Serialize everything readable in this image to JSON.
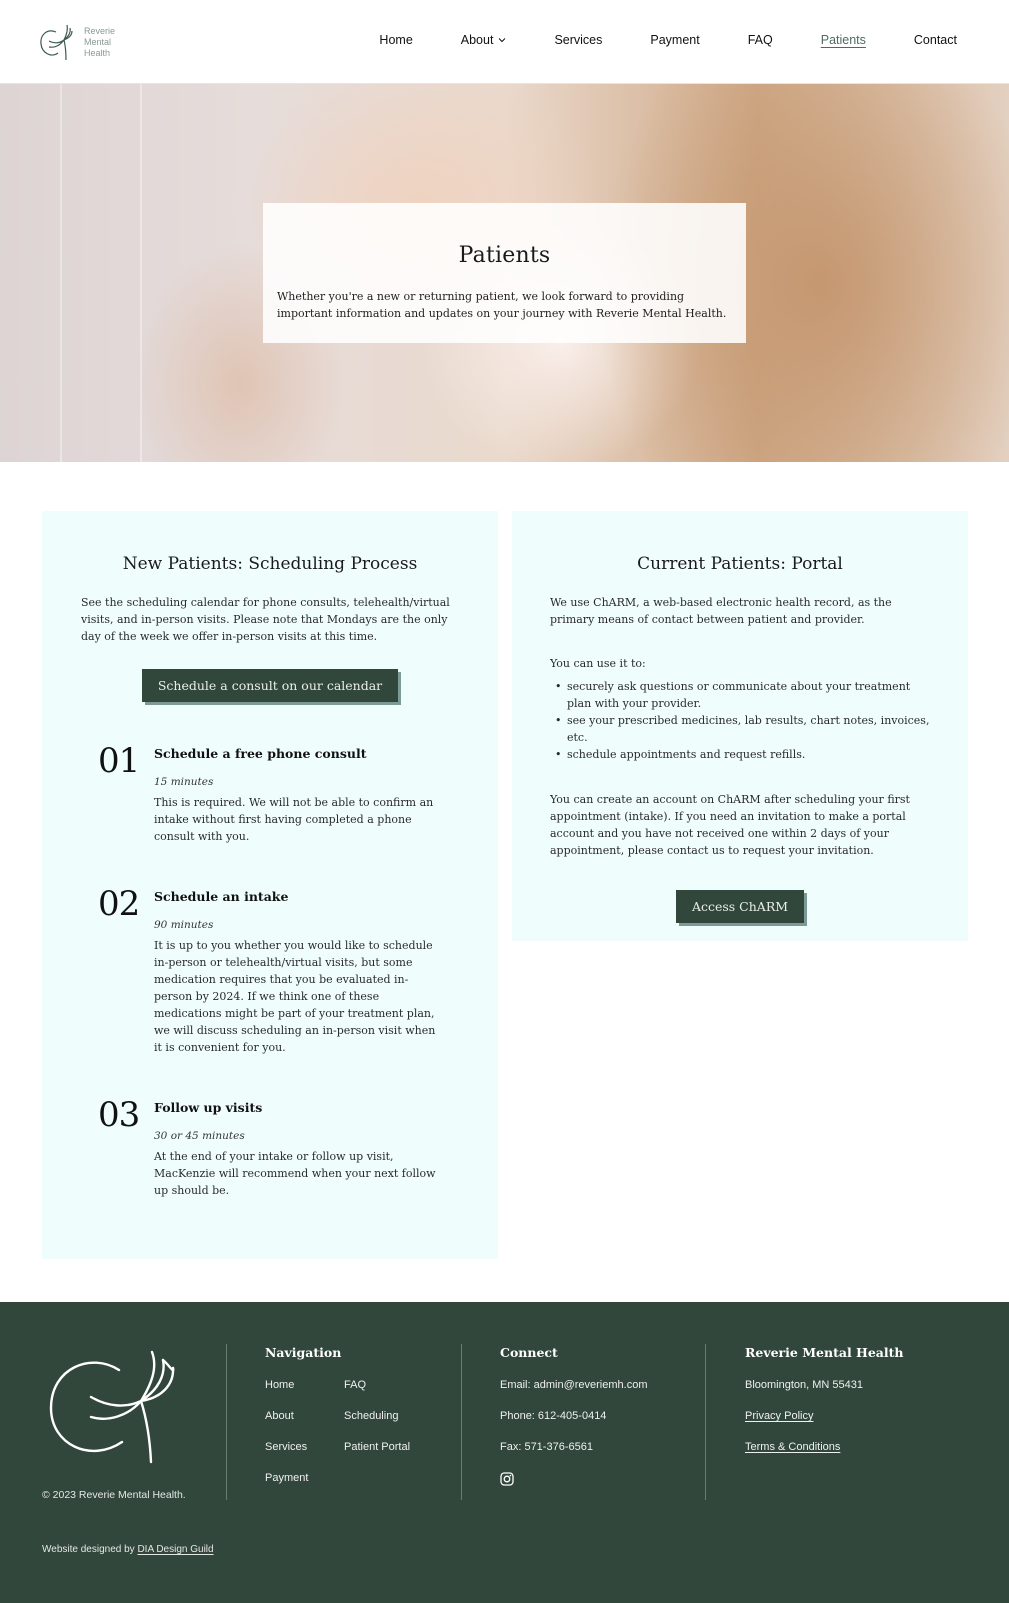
{
  "header": {
    "logo_lines": [
      "Reverie",
      "Mental",
      "Health"
    ],
    "nav": [
      {
        "label": "Home",
        "active": false,
        "has_dropdown": false
      },
      {
        "label": "About",
        "active": false,
        "has_dropdown": true
      },
      {
        "label": "Services",
        "active": false,
        "has_dropdown": false
      },
      {
        "label": "Payment",
        "active": false,
        "has_dropdown": false
      },
      {
        "label": "FAQ",
        "active": false,
        "has_dropdown": false
      },
      {
        "label": "Patients",
        "active": true,
        "has_dropdown": false
      },
      {
        "label": "Contact",
        "active": false,
        "has_dropdown": false
      }
    ]
  },
  "hero": {
    "title": "Patients",
    "description": "Whether you're a new or returning patient, we look forward to providing important information and updates on your journey with Reverie Mental Health."
  },
  "new_patients": {
    "title": "New Patients: Scheduling Process",
    "intro": "See the scheduling calendar for phone consults, telehealth/virtual visits, and in-person visits. Please note that Mondays are the only day of the week we offer in-person visits at this time.",
    "button_label": "Schedule a consult on our calendar",
    "steps": [
      {
        "number": "01",
        "title": "Schedule a free phone consult",
        "duration": "15 minutes",
        "description": "This is required. We will not be able to confirm an intake without first having completed a phone consult with you."
      },
      {
        "number": "02",
        "title": "Schedule an intake",
        "duration": "90 minutes",
        "description": "It is up to you whether you would like to schedule in-person or telehealth/virtual visits, but some medication requires that you be evaluated in-person by 2024. If we think one of these medications might be part of your treatment plan, we will discuss scheduling an in-person visit when it is convenient for you."
      },
      {
        "number": "03",
        "title": "Follow up visits",
        "duration": "30 or 45 minutes",
        "description": "At the end of your intake or follow up visit, MacKenzie will recommend when your next follow up should be."
      }
    ]
  },
  "current_patients": {
    "title": "Current Patients: Portal",
    "paragraph1": "We use ChARM, a web-based electronic health record, as the primary means of contact between patient and provider.",
    "paragraph2": "You can use it to:",
    "bullets": [
      "securely ask questions or communicate about your treatment plan with your provider.",
      "see your prescribed medicines, lab results, chart notes, invoices, etc.",
      "schedule appointments and request refills."
    ],
    "paragraph3": "You can create an account on ChARM after scheduling your first appointment (intake). If you need an invitation to make a portal account and you have not received one within 2 days of your appointment, please contact us to request your invitation.",
    "button_label": "Access ChARM"
  },
  "footer": {
    "copyright": "© 2023 Reverie Mental Health.",
    "navigation": {
      "heading": "Navigation",
      "links": [
        "Home",
        "FAQ",
        "About",
        "Scheduling",
        "Services",
        "Patient Portal",
        "Payment"
      ]
    },
    "connect": {
      "heading": "Connect",
      "email": "Email: admin@reveriemh.com",
      "phone": "Phone: 612-405-0414",
      "fax": "Fax: 571-376-6561",
      "social_icon": "instagram-icon"
    },
    "company": {
      "heading": "Reverie Mental Health",
      "address": "Bloomington, MN 55431",
      "privacy": "Privacy Policy",
      "terms": "Terms & Conditions"
    },
    "credit_prefix": "Website designed by ",
    "credit_link": "DIA Design Guild"
  },
  "colors": {
    "brand_dark_green": "#31473b",
    "panel_bg": "#f0fdfd",
    "button_shadow": "#7d9a96",
    "active_nav": "#4e6b5e"
  }
}
